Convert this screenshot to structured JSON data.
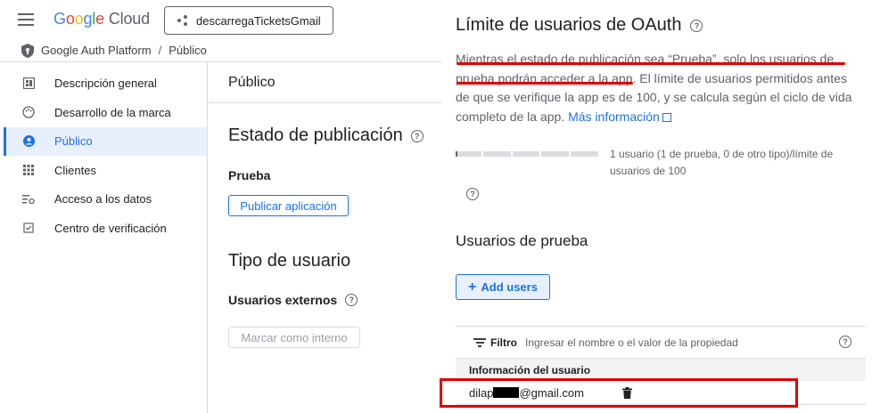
{
  "header": {
    "logo": {
      "g1": "G",
      "g2": "o",
      "g3": "o",
      "g4": "g",
      "g5": "l",
      "g6": "e",
      "product": "Cloud"
    },
    "project": "descarregaTicketsGmail"
  },
  "breadcrumb": {
    "root": "Google Auth Platform",
    "separator": "/",
    "current": "Público"
  },
  "sidebar": {
    "items": [
      {
        "label": "Descripción general",
        "icon": "dashboard-icon"
      },
      {
        "label": "Desarrollo de la marca",
        "icon": "palette-icon"
      },
      {
        "label": "Público",
        "icon": "person-icon",
        "active": true
      },
      {
        "label": "Clientes",
        "icon": "grid-icon"
      },
      {
        "label": "Acceso a los datos",
        "icon": "data-access-icon"
      },
      {
        "label": "Centro de verificación",
        "icon": "check-box-icon"
      }
    ]
  },
  "middle": {
    "header": "Público",
    "publishing": {
      "title": "Estado de publicación",
      "status": "Prueba",
      "publish_button": "Publicar aplicación"
    },
    "user_type": {
      "title": "Tipo de usuario",
      "value": "Usuarios externos",
      "mark_internal_button": "Marcar como interno"
    }
  },
  "oauth_panel": {
    "title": "Límite de usuarios de OAuth",
    "description": {
      "line1": "Mientras el estado de publicación sea “Prueba”, solo los usuarios de",
      "line2_underlined": "prueba podrán acceder a la app",
      "line2_rest": ". El límite de usuarios permitidos antes de que se verifique la app es de 100, y se calcula según el ciclo de vida completo de la app.",
      "link": "Más información"
    },
    "usage": {
      "text": "1 usuario (1 de prueba, 0 de otro tipo)/límite de usuarios de 100",
      "used": 1,
      "limit": 100
    },
    "test_users": {
      "title": "Usuarios de prueba",
      "add_button": "Add users",
      "filter_label": "Filtro",
      "filter_placeholder": "Ingresar el nombre o el valor de la propiedad",
      "column_header": "Información del usuario",
      "rows": [
        {
          "email_prefix": "dilap",
          "email_suffix": "@gmail.com"
        }
      ]
    }
  },
  "colors": {
    "accent": "#1a73e8",
    "annotation_red": "#e00000"
  }
}
